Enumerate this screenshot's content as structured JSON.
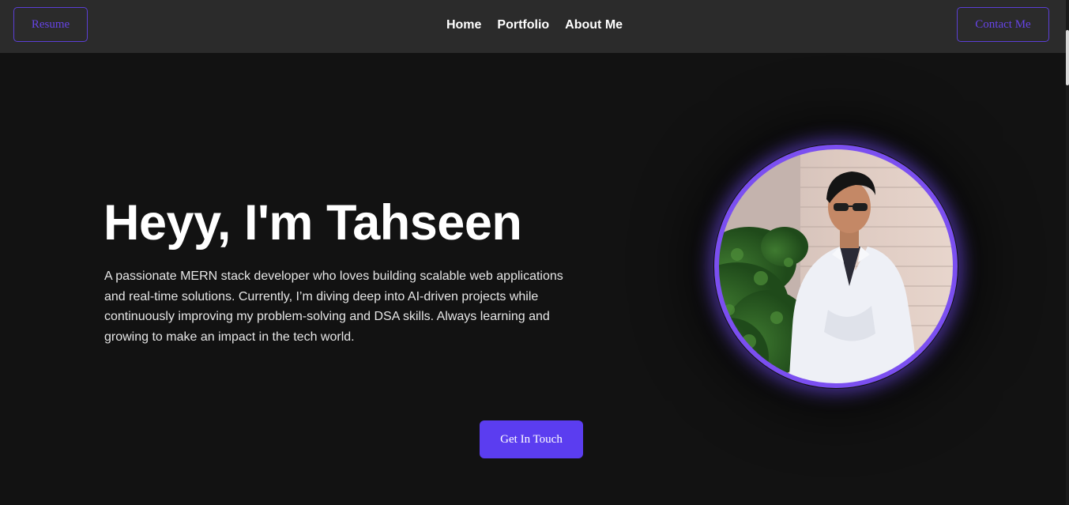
{
  "nav": {
    "resume_label": "Resume",
    "links": [
      "Home",
      "Portfolio",
      "About Me"
    ],
    "contact_label": "Contact Me"
  },
  "hero": {
    "title": "Heyy, I'm Tahseen",
    "description": "A passionate MERN stack developer who loves building scalable web applications and real-time solutions. Currently, I’m diving deep into AI-driven projects while continuously improving my problem-solving and DSA skills. Always learning and growing to make an impact in the tech world.",
    "cta_label": "Get In Touch"
  },
  "colors": {
    "accent": "#5b3df0",
    "navbar_bg": "#2b2b2b",
    "page_bg": "#121212",
    "avatar_ring": "#7b4ff0"
  }
}
